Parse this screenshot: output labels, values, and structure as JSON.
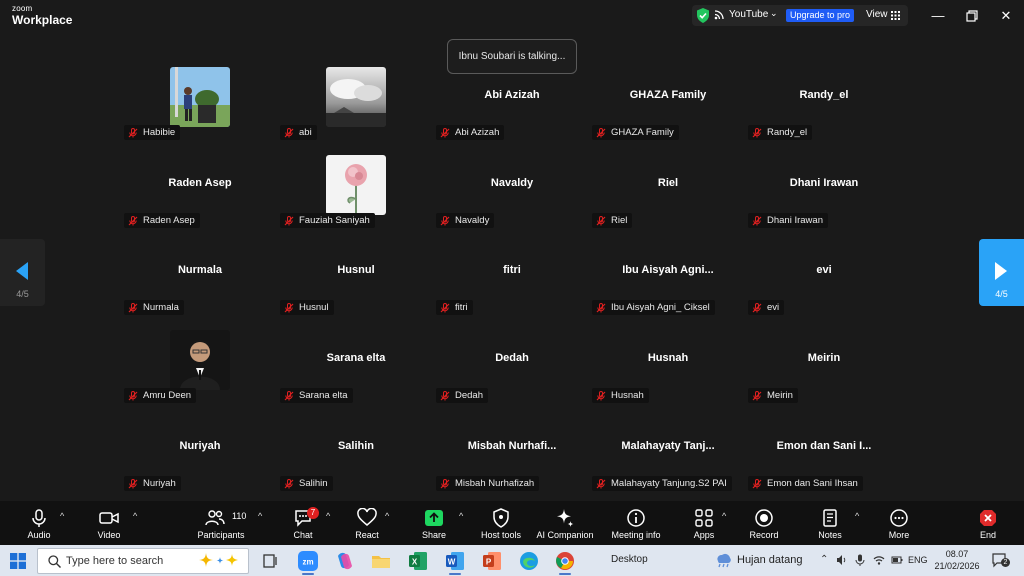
{
  "titlebar": {
    "brand_top": "zoom",
    "brand_bottom": "Workplace",
    "streaming_label": "YouTube",
    "upgrade_label": "Upgrade to pro",
    "view_label": "View"
  },
  "talking_indicator": "Ibnu Soubari is talking...",
  "gallery": {
    "rows": [
      [
        {
          "tag": "Habibie",
          "big": "",
          "avatar": "photo-man-field"
        },
        {
          "tag": "abi",
          "big": "",
          "avatar": "photo-clouds"
        },
        {
          "tag": "Abi Azizah",
          "big": "Abi Azizah",
          "avatar": ""
        },
        {
          "tag": "GHAZA Family",
          "big": "GHAZA Family",
          "avatar": ""
        },
        {
          "tag": "Randy_el",
          "big": "Randy_el",
          "avatar": ""
        }
      ],
      [
        {
          "tag": "Raden Asep",
          "big": "Raden Asep",
          "avatar": ""
        },
        {
          "tag": "Fauziah Saniyah",
          "big": "",
          "avatar": "photo-rose"
        },
        {
          "tag": "Navaldy",
          "big": "Navaldy",
          "avatar": ""
        },
        {
          "tag": "Riel",
          "big": "Riel",
          "avatar": ""
        },
        {
          "tag": "Dhani Irawan",
          "big": "Dhani Irawan",
          "avatar": ""
        }
      ],
      [
        {
          "tag": "Nurmala",
          "big": "Nurmala",
          "avatar": ""
        },
        {
          "tag": "Husnul",
          "big": "Husnul",
          "avatar": ""
        },
        {
          "tag": "fitri",
          "big": "fitri",
          "avatar": ""
        },
        {
          "tag": "Ibu Aisyah Agni_ Ciksel",
          "big": "Ibu Aisyah Agni...",
          "avatar": ""
        },
        {
          "tag": "evi",
          "big": "evi",
          "avatar": ""
        }
      ],
      [
        {
          "tag": "Amru Deen",
          "big": "",
          "avatar": "photo-man-suit"
        },
        {
          "tag": "Sarana elta",
          "big": "Sarana elta",
          "avatar": ""
        },
        {
          "tag": "Dedah",
          "big": "Dedah",
          "avatar": ""
        },
        {
          "tag": "Husnah",
          "big": "Husnah",
          "avatar": ""
        },
        {
          "tag": "Meirin",
          "big": "Meirin",
          "avatar": ""
        }
      ],
      [
        {
          "tag": "Nuriyah",
          "big": "Nuriyah",
          "avatar": ""
        },
        {
          "tag": "Salihin",
          "big": "Salihin",
          "avatar": ""
        },
        {
          "tag": "Misbah Nurhafizah",
          "big": "Misbah  Nurhafi...",
          "avatar": ""
        },
        {
          "tag": "Malahayaty Tanjung.S2 PAI",
          "big": "Malahayaty  Tanj...",
          "avatar": ""
        },
        {
          "tag": "Emon dan Sani Ihsan",
          "big": "Emon dan Sani I...",
          "avatar": ""
        }
      ]
    ]
  },
  "pager": {
    "prev_label": "4/5",
    "next_label": "4/5"
  },
  "toolbar": {
    "audio": "Audio",
    "video": "Video",
    "participants": "Participants",
    "participants_count": "110",
    "chat": "Chat",
    "chat_badge": "7",
    "react": "React",
    "share": "Share",
    "host_tools": "Host tools",
    "ai_companion": "AI Companion",
    "meeting_info": "Meeting info",
    "apps": "Apps",
    "record": "Record",
    "notes": "Notes",
    "more": "More",
    "end": "End"
  },
  "taskbar": {
    "search_placeholder": "Type here to search",
    "desktop_label": "Desktop",
    "weather": "Hujan datang",
    "lang": "ENG",
    "time": "08.07",
    "date": "21/02/2026",
    "notification_count": "2"
  },
  "colors": {
    "background": "#1a1a1a",
    "accent_blue": "#2aa3f7",
    "upgrade_blue": "#1f5cf5",
    "muted_red": "#e02020",
    "share_green": "#1ed760",
    "end_red": "#e02b2b"
  }
}
